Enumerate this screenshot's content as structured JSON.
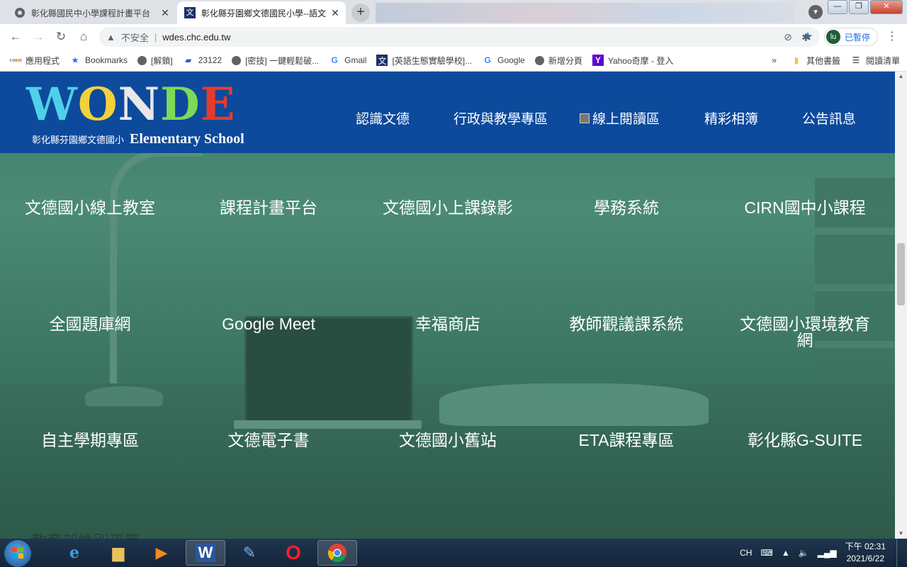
{
  "browser": {
    "tabs": [
      {
        "title": "彰化縣國民中小學課程計畫平台",
        "active": false
      },
      {
        "title": "彰化縣芬園鄉文德國民小學--語文",
        "active": true
      }
    ],
    "profile_initial": "lu",
    "address": {
      "security_label": "不安全",
      "url": "wdes.chc.edu.tw"
    },
    "sync_chip_label": "已暫停",
    "bookmarks": [
      {
        "label": "應用程式",
        "icon": "apps-grid-icon"
      },
      {
        "label": "Bookmarks",
        "icon": "star-icon"
      },
      {
        "label": "[解鎖]",
        "icon": "globe-icon"
      },
      {
        "label": "23122",
        "icon": "blue-note-icon"
      },
      {
        "label": "[密技] 一鍵輕鬆破...",
        "icon": "globe-icon"
      },
      {
        "label": "Gmail",
        "icon": "google-icon"
      },
      {
        "label": "[英語生態實驗學校]...",
        "icon": "wen-icon"
      },
      {
        "label": "Google",
        "icon": "google-icon"
      },
      {
        "label": "新增分頁",
        "icon": "globe-icon"
      },
      {
        "label": "Yahoo奇摩 - 登入",
        "icon": "yahoo-icon"
      }
    ],
    "bookmarks_right": [
      {
        "label": "其他書籤",
        "icon": "folder-icon"
      },
      {
        "label": "閱讀清單",
        "icon": "reading-list-icon"
      }
    ]
  },
  "site": {
    "logo_letters": [
      "W",
      "O",
      "N",
      "D",
      "E"
    ],
    "logo_letter_colors": [
      "#4fd0ea",
      "#f2d23a",
      "#e8e8e8",
      "#7ed957",
      "#e53b2c"
    ],
    "logo_sub_cn": "彰化縣芬園鄉文德國小",
    "logo_sub_en": "Elementary School",
    "nav": [
      "認識文德",
      "行政與教學專區",
      "線上閱讀區",
      "精彩相簿",
      "公告訊息"
    ],
    "tiles": [
      [
        "文德國小線上教室",
        "課程計畫平台",
        "文德國小上課錄影",
        "學務系統",
        "CIRN國中小課程"
      ],
      [
        "全國題庫網",
        "Google Meet",
        "幸福商店",
        "教師觀議課系統",
        "文德國小環境教育網"
      ],
      [
        "自主學期專區",
        "文德電子書",
        "文德國小舊站",
        "ETA課程專區",
        "彰化縣G-SUITE"
      ]
    ],
    "bottom_heading": "教育部性別平等"
  },
  "taskbar": {
    "apps": [
      "ie-icon",
      "file-explorer-icon",
      "media-player-icon",
      "word-icon",
      "paint-icon",
      "opera-icon",
      "chrome-icon"
    ],
    "ime": "CH",
    "clock_time": "下午 02:31",
    "clock_date": "2021/6/22"
  },
  "colors": {
    "header_bg": "#0d4a9c",
    "page_bg": "#3c7a66",
    "accent": "#1a73e8"
  }
}
